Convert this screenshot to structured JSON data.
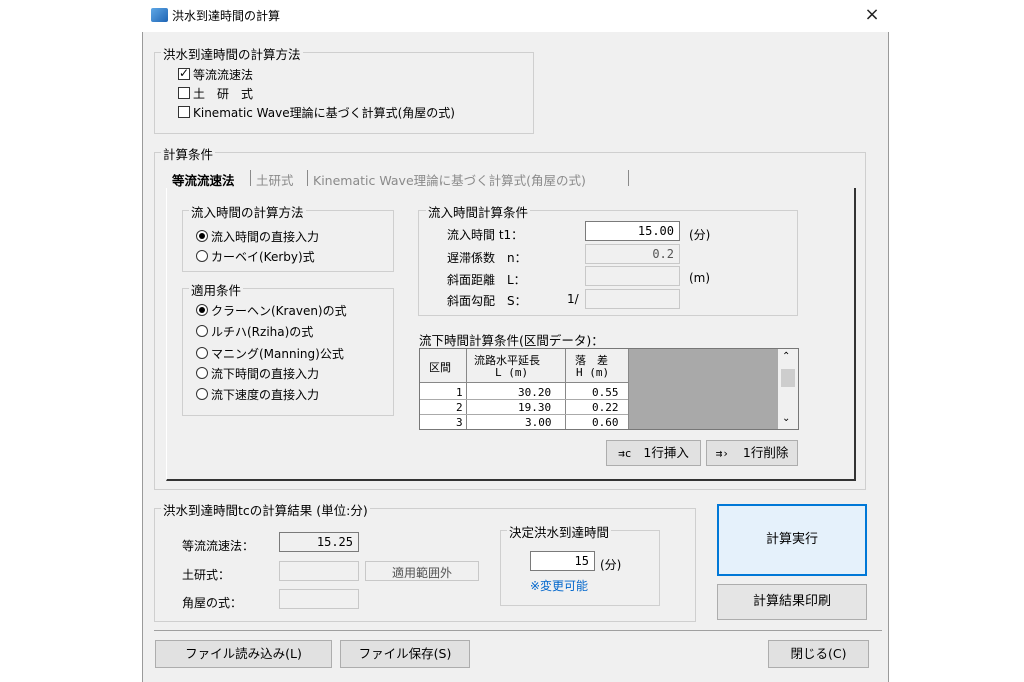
{
  "window": {
    "title": "洪水到達時間の計算",
    "close": "×"
  },
  "method_group": {
    "legend": "洪水到達時間の計算方法",
    "options": [
      {
        "label": "等流流速法",
        "checked": true
      },
      {
        "label": "土　研　式",
        "checked": false
      },
      {
        "label": "Kinematic Wave理論に基づく計算式(角屋の式)",
        "checked": false
      }
    ]
  },
  "conditions": {
    "legend": "計算条件",
    "tabs": [
      "等流流速法",
      "土研式",
      "Kinematic Wave理論に基づく計算式(角屋の式)"
    ],
    "inflow_method": {
      "legend": "流入時間の計算方法",
      "options": [
        {
          "label": "流入時間の直接入力",
          "selected": true
        },
        {
          "label": "カーベイ(Kerby)式",
          "selected": false
        }
      ]
    },
    "apply": {
      "legend": "適用条件",
      "options": [
        {
          "label": "クラーヘン(Kraven)の式",
          "selected": true
        },
        {
          "label": "ルチハ(Rziha)の式",
          "selected": false
        },
        {
          "label": "マニング(Manning)公式",
          "selected": false
        },
        {
          "label": "流下時間の直接入力",
          "selected": false
        },
        {
          "label": "流下速度の直接入力",
          "selected": false
        }
      ]
    },
    "inflow_calc": {
      "legend": "流入時間計算条件",
      "t1_label": "流入時間 t1：",
      "t1_value": "15.00",
      "t1_unit": "(分)",
      "n_label": "遅滞係数　n：",
      "n_value": "0.2",
      "L_label": "斜面距離　L：",
      "L_value": "",
      "L_unit": "(m)",
      "S_label": "斜面勾配　S：",
      "S_prefix": "1/",
      "S_value": ""
    },
    "section": {
      "title": "流下時間計算条件(区間データ)：",
      "headers": {
        "col0": "区間",
        "col1": "流路水平延長",
        "col1_unit": "L (m)",
        "col2": "落　差",
        "col2_unit": "H (m)"
      },
      "rows": [
        {
          "no": "1",
          "L": "30.20",
          "H": "0.55"
        },
        {
          "no": "2",
          "L": "19.30",
          "H": "0.22"
        },
        {
          "no": "3",
          "L": "3.00",
          "H": "0.60"
        }
      ],
      "insert_btn": "1行挿入",
      "delete_btn": "1行削除"
    }
  },
  "result": {
    "legend": "洪水到達時間tcの計算結果 (単位:分)",
    "equal_label": "等流流速法：",
    "equal_value": "15.25",
    "doken_label": "土研式：",
    "doken_value": "",
    "doken_note": "適用範囲外",
    "kadoya_label": "角屋の式：",
    "kadoya_value": "",
    "decision": {
      "legend": "決定洪水到達時間",
      "value": "15",
      "unit": "(分)",
      "note": "※変更可能"
    }
  },
  "buttons": {
    "calc": "計算実行",
    "print": "計算結果印刷",
    "load": "ファイル読み込み(L)",
    "save": "ファイル保存(S)",
    "close": "閉じる(C)"
  },
  "colors": {
    "accent": "#0078d7",
    "note": "#0066cc"
  }
}
